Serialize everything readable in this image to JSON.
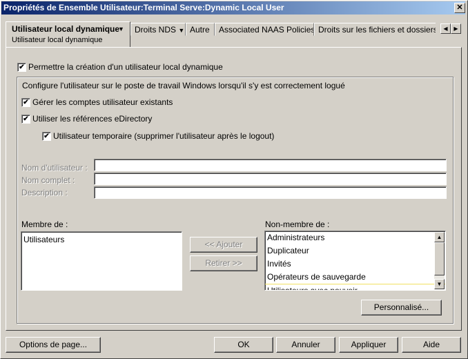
{
  "window": {
    "title": "Propriétés de Ensemble Utilisateur:Terminal Serve:Dynamic Local User",
    "close": "✕"
  },
  "tabs": [
    {
      "label": "Utilisateur local dynamique",
      "sub": "Utilisateur local dynamique"
    },
    {
      "label": "Droits NDS"
    },
    {
      "label": "Autre"
    },
    {
      "label": "Associated NAAS Policies"
    },
    {
      "label": "Droits sur les fichiers et dossiers"
    }
  ],
  "dropdown": "▼",
  "scroll_left": "◀",
  "scroll_right": "▶",
  "main": {
    "enable_label": "Permettre la création d'un utilisateur local dynamique",
    "enable_checked": true,
    "configure_text": "Configure l'utilisateur sur le poste de travail Windows lorsqu'il s'y est correctement logué",
    "manage_label": "Gérer les comptes utilisateur existants",
    "manage_checked": true,
    "edir_label": "Utiliser les références eDirectory",
    "edir_checked": true,
    "temp_label": "Utilisateur temporaire (supprimer l'utilisateur après le logout)",
    "temp_checked": true,
    "check": "✔",
    "username_label": "Nom d'utilisateur :",
    "username_value": "",
    "fullname_label": "Nom complet :",
    "fullname_value": "",
    "description_label": "Description :",
    "description_value": "",
    "member_label": "Membre de :",
    "member_items": [
      "Utilisateurs"
    ],
    "nonmember_label": "Non-membre de :",
    "nonmember_items": [
      "Administrateurs",
      "Duplicateur",
      "Invités",
      "Opérateurs de sauvegarde",
      "Utilisateurs avec pouvoir"
    ],
    "add_button": "<< Ajouter",
    "remove_button": "Retirer >>",
    "custom_button": "Personnalisé..."
  },
  "footer": {
    "page_options": "Options de page...",
    "ok": "OK",
    "cancel": "Annuler",
    "apply": "Appliquer",
    "help": "Aide"
  }
}
